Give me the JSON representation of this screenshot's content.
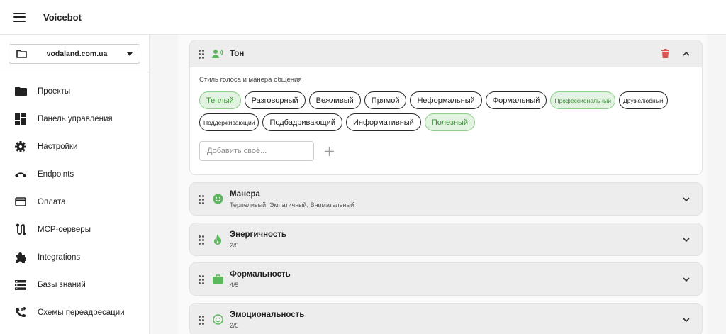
{
  "app": {
    "title": "Voicebot"
  },
  "sidebar": {
    "domain": "vodaland.com.ua",
    "items": [
      {
        "label": "Проекты",
        "icon": "folder-icon"
      },
      {
        "label": "Панель управления",
        "icon": "dashboard-icon"
      },
      {
        "label": "Настройки",
        "icon": "gear-icon"
      },
      {
        "label": "Endpoints",
        "icon": "phone-hangup-icon"
      },
      {
        "label": "Оплата",
        "icon": "credit-card-icon"
      },
      {
        "label": "MCP-серверы",
        "icon": "route-icon"
      },
      {
        "label": "Integrations",
        "icon": "puzzle-icon"
      },
      {
        "label": "Базы знаний",
        "icon": "storage-icon"
      },
      {
        "label": "Схемы переадресации",
        "icon": "phone-forward-icon"
      }
    ]
  },
  "ton": {
    "title": "Тон",
    "label": "Стиль голоса и манера общения",
    "chips": [
      {
        "label": "Теплый",
        "selected": true
      },
      {
        "label": "Разговорный",
        "selected": false
      },
      {
        "label": "Вежливый",
        "selected": false
      },
      {
        "label": "Прямой",
        "selected": false
      },
      {
        "label": "Неформальный",
        "selected": false
      },
      {
        "label": "Формальный",
        "selected": false
      },
      {
        "label": "Профессиональный",
        "selected": true,
        "small": true
      },
      {
        "label": "Дружелюбный",
        "selected": false,
        "small": true
      },
      {
        "label": "Поддерживающий",
        "selected": false,
        "small": true
      },
      {
        "label": "Подбадривающий",
        "selected": false
      },
      {
        "label": "Информативный",
        "selected": false
      },
      {
        "label": "Полезный",
        "selected": true
      }
    ],
    "add_placeholder": "Добавить своё..."
  },
  "sections": [
    {
      "title": "Манера",
      "sub": "Терпеливый, Эмпатичный, Внимательный",
      "icon": "smile-icon"
    },
    {
      "title": "Энергичность",
      "sub": "2/5",
      "icon": "fire-icon"
    },
    {
      "title": "Формальность",
      "sub": "4/5",
      "icon": "briefcase-icon"
    },
    {
      "title": "Эмоциональность",
      "sub": "2/5",
      "icon": "smile-outline-icon"
    }
  ],
  "colors": {
    "accent_green": "#5cb85c",
    "chip_selected_bg": "#e3f3e1",
    "delete_red": "#e05252"
  }
}
